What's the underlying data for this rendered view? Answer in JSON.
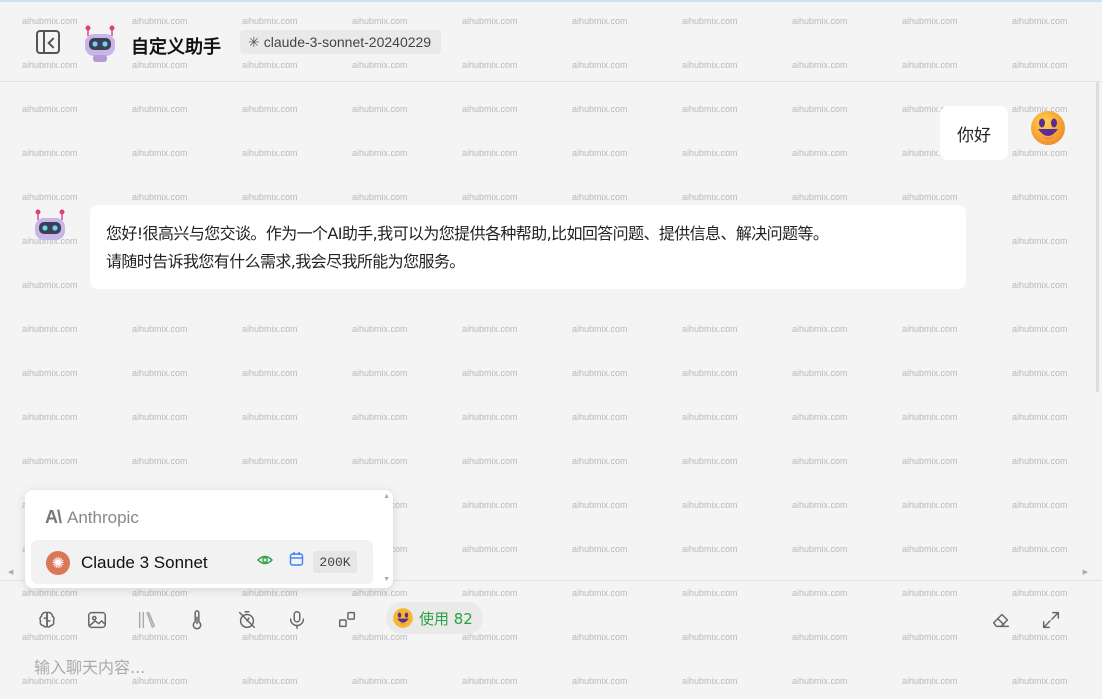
{
  "watermark_text": "aihubmix.com",
  "header": {
    "title": "自定义助手",
    "model_chip": "claude-3-sonnet-20240229",
    "model_chip_icon": "anthropic-star-icon"
  },
  "messages": [
    {
      "role": "user",
      "text": "你好",
      "avatar": "grinning-emoji-icon"
    },
    {
      "role": "assistant",
      "avatar": "robot-icon",
      "lines": [
        "您好!很高兴与您交谈。作为一个AI助手,我可以为您提供各种帮助,比如回答问题、提供信息、解决问题等。",
        "请随时告诉我您有什么需求,我会尽我所能为您服务。"
      ]
    }
  ],
  "model_popup": {
    "provider_logo": "A\\",
    "provider_name": "Anthropic",
    "models": [
      {
        "name": "Claude 3 Sonnet",
        "icon": "claude-sparkle-icon",
        "capabilities": [
          "vision-eye-icon",
          "web-calendar-icon"
        ],
        "context": "200K"
      }
    ]
  },
  "toolbar": {
    "tools": [
      "brain-icon",
      "image-icon",
      "library-icon",
      "thermometer-icon",
      "timer-off-icon",
      "microphone-icon",
      "widgets-icon"
    ],
    "usage_label": "使用 82",
    "right_tools": [
      "eraser-icon",
      "expand-icon"
    ]
  },
  "composer": {
    "placeholder": "输入聊天内容..."
  },
  "colors": {
    "accent_green": "#2aa140",
    "claude_orange": "#d97757",
    "background": "#f4f4f4"
  }
}
